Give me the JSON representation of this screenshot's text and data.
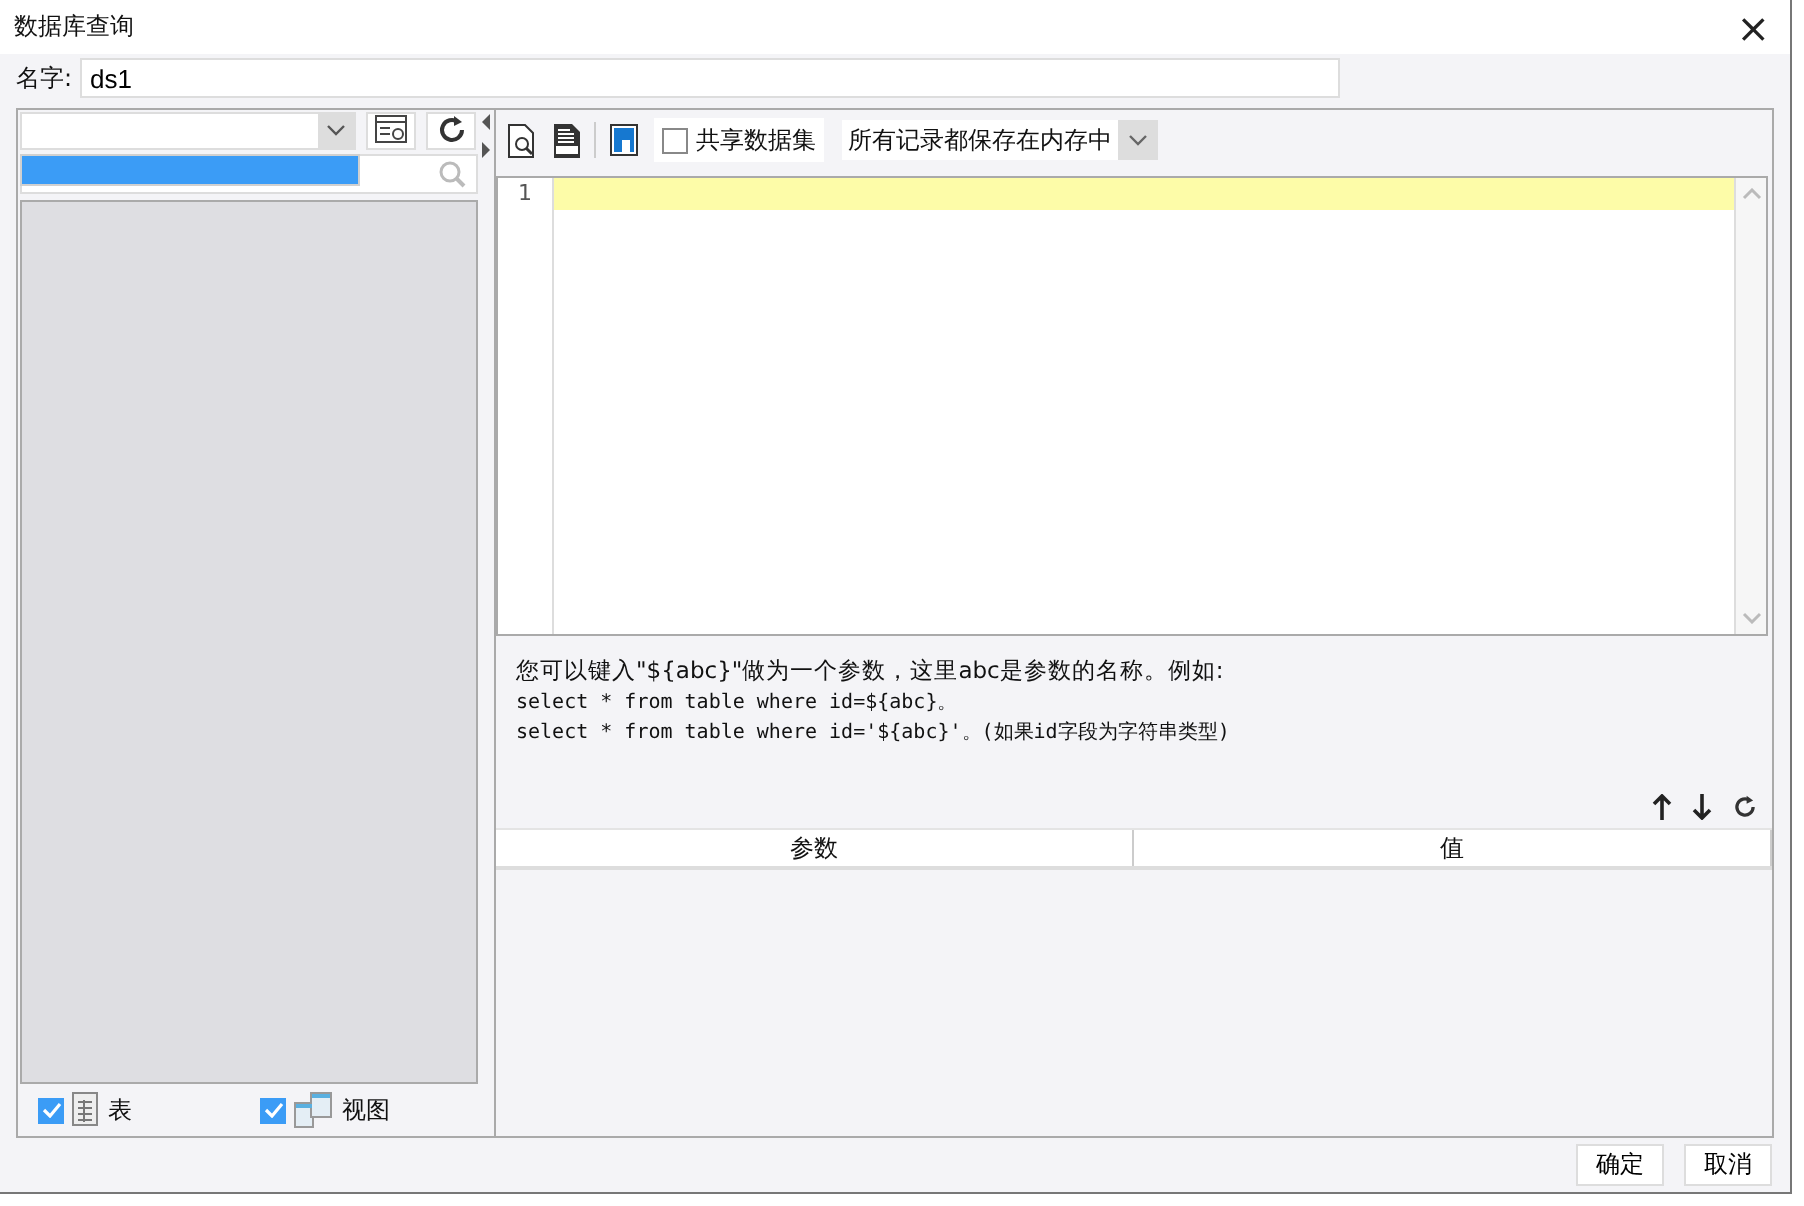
{
  "window": {
    "title": "数据库查询",
    "close": "×"
  },
  "name_field": {
    "label": "名字:",
    "value": "ds1"
  },
  "left_panel": {
    "connection_dropdown": {
      "expanded": true
    },
    "filters": [
      {
        "label": "表",
        "checked": true,
        "kind": "table"
      },
      {
        "label": "视图",
        "checked": true,
        "kind": "view"
      }
    ]
  },
  "toolbar": {
    "share_dataset": {
      "label": "共享数据集",
      "checked": false
    },
    "storage_mode": {
      "value": "所有记录都保存在内存中"
    }
  },
  "editor": {
    "lines": [
      {
        "number": "1",
        "current": true
      }
    ]
  },
  "hint": {
    "lines": [
      "您可以键入\"${abc}\"做为一个参数，这里abc是参数的名称。例如:",
      "select * from table where id=${abc}。",
      "select * from table where id='${abc}'。(如果id字段为字符串类型)"
    ]
  },
  "param_table": {
    "columns": [
      "参数",
      "值"
    ]
  },
  "buttons": [
    "确定",
    "取消"
  ]
}
